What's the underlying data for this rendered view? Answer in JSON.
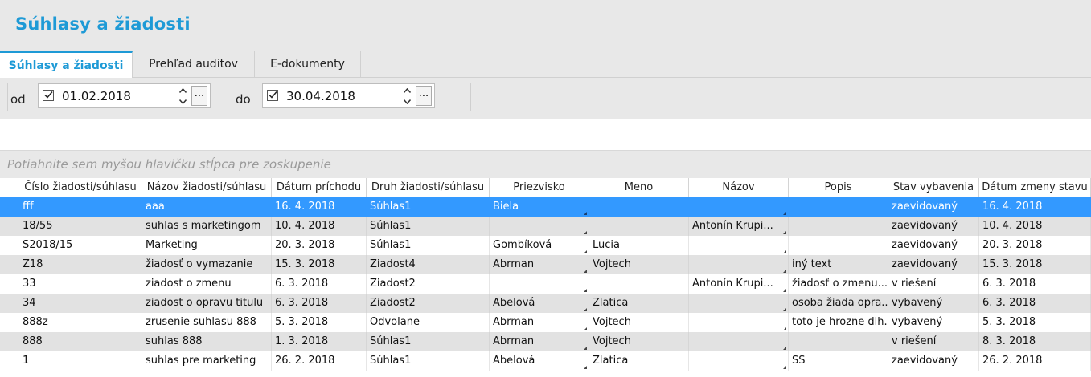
{
  "app": {
    "title": "Súhlasy a žiadosti"
  },
  "tabs": [
    {
      "label": "Súhlasy a žiadosti",
      "active": true
    },
    {
      "label": "Prehľad auditov",
      "active": false
    },
    {
      "label": "E-dokumenty",
      "active": false
    }
  ],
  "filter": {
    "from_label": "od",
    "from_date": "01.02.2018",
    "from_checked": true,
    "to_label": "do",
    "to_date": "30.04.2018",
    "to_checked": true,
    "browse_label": "..."
  },
  "grid": {
    "group_hint": "Potiahnite sem myšou hlavičku stĺpca pre zoskupenie",
    "columns": [
      "Číslo žiadosti/súhlasu",
      "Názov žiadosti/súhlasu",
      "Dátum príchodu",
      "Druh žiadosti/súhlasu",
      "Priezvisko",
      "Meno",
      "Názov",
      "Popis",
      "Stav vybavenia",
      "Dátum zmeny stavu"
    ],
    "selected_row": 0,
    "rows": [
      [
        "fff",
        "aaa",
        "16. 4. 2018",
        "Súhlas1",
        "Biela",
        "",
        "",
        "",
        "zaevidovaný",
        "16. 4. 2018"
      ],
      [
        "18/55",
        "suhlas s marketingom",
        "10. 4. 2018",
        "Súhlas1",
        "",
        "",
        "Antonín Krupi...",
        "",
        "zaevidovaný",
        "10. 4. 2018"
      ],
      [
        "S2018/15",
        "Marketing",
        "20. 3. 2018",
        "Súhlas1",
        "Gombíková",
        "Lucia",
        "",
        "",
        "zaevidovaný",
        "20. 3. 2018"
      ],
      [
        "Z18",
        "žiadosť o vymazanie",
        "15. 3. 2018",
        "Ziadost4",
        "Abrman",
        "Vojtech",
        "",
        "iný text",
        "zaevidovaný",
        "15. 3. 2018"
      ],
      [
        "33",
        "ziadost o zmenu",
        "6. 3. 2018",
        "Ziadost2",
        "",
        "",
        "Antonín Krupi...",
        "žiadosť o zmenu...",
        "v riešení",
        "6. 3. 2018"
      ],
      [
        "34",
        "ziadost o opravu titulu",
        "6. 3. 2018",
        "Ziadost2",
        "Abelová",
        "Zlatica",
        "",
        "osoba žiada opra...",
        "vybavený",
        "6. 3. 2018"
      ],
      [
        "888z",
        "zrusenie suhlasu 888",
        "5. 3. 2018",
        "Odvolane",
        "Abrman",
        "Vojtech",
        "",
        "toto je hrozne dlh...",
        "vybavený",
        "5. 3. 2018"
      ],
      [
        "888",
        "suhlas 888",
        "1. 3. 2018",
        "Súhlas1",
        "Abrman",
        "Vojtech",
        "",
        "",
        "v riešení",
        "8. 3. 2018"
      ],
      [
        "1",
        "suhlas pre marketing",
        "26. 2. 2018",
        "Súhlas1",
        "Abelová",
        "Zlatica",
        "",
        "SS",
        "zaevidovaný",
        "26. 2. 2018"
      ]
    ]
  },
  "colors": {
    "accent": "#1e9ad6",
    "selection": "#3399ff",
    "alt_row": "#e2e2e2",
    "panel": "#e8e8e8"
  }
}
